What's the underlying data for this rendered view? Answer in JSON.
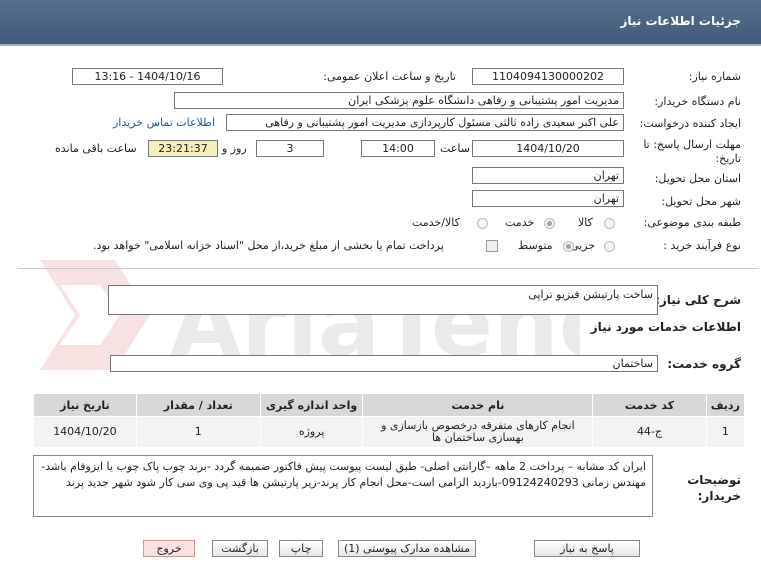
{
  "header": {
    "title": "جزئیات اطلاعات نیاز"
  },
  "form": {
    "need_number_label": "شماره نیاز:",
    "need_number": "1104094130000202",
    "announce_label": "تاریخ و ساعت اعلان عمومی:",
    "announce_value": "1404/10/16 - 13:16",
    "buyer_org_label": "نام دستگاه خریدار:",
    "buyer_org": "مدیریت امور پشتیبانی و رفاهی دانشگاه علوم پزشکی ایران",
    "creator_label": "ایجاد کننده درخواست:",
    "creator": "علی اکبر سعیدی زاده ثالثی مسئول کارپردازی مدیریت امور پشتیبانی و رفاهی",
    "contact_link": "اطلاعات تماس خریدار",
    "deadline_label_1": "مهلت ارسال پاسخ: تا",
    "deadline_label_2": "تاریخ:",
    "deadline_date": "1404/10/20",
    "time_label": "ساعت",
    "deadline_time": "14:00",
    "days_value": "3",
    "days_label": "روز و",
    "remaining_time": "23:21:37",
    "remaining_label": "ساعت باقی مانده",
    "province_label": "استان محل تحویل:",
    "province": "تهران",
    "city_label": "شهر محل تحویل:",
    "city": "تهران",
    "category_label": "طبقه بندی موضوعی:",
    "category_options": [
      "کالا",
      "خدمت",
      "کالا/خدمت"
    ],
    "process_label": "نوع فرآیند خرید :",
    "process_options": [
      "جزیی",
      "متوسط"
    ],
    "payment_text": "پرداخت تمام یا بخشی از مبلغ خرید،از محل \"اسناد خزانه اسلامی\" خواهد بود."
  },
  "summary": {
    "label": "شرح کلی نیاز:",
    "value": "ساخت پارتیشن فیزیو تراپی"
  },
  "services": {
    "section_title": "اطلاعات خدمات مورد نیاز",
    "group_label": "گروه خدمت:",
    "group_value": "ساختمان",
    "columns": [
      "ردیف",
      "کد خدمت",
      "نام خدمت",
      "واحد اندازه گیری",
      "تعداد / مقدار",
      "تاریخ نیاز"
    ],
    "rows": [
      [
        "1",
        "ج-44",
        "انجام کارهای متفرقه درخصوص بازسازی و بهسازی ساختمان ها",
        "پروژه",
        "1",
        "1404/10/20"
      ]
    ]
  },
  "buyer_notes": {
    "label_1": "توضیحات",
    "label_2": "خریدار:",
    "text": "ایران کد مشابه – پرداخت 2 ماهه –گارانتی اصلی- طبق لیست پیوست پیش فاکتور ضمیمه گردد -برند چوب پاک چوب یا ایزوفام باشد-مهندس زمانی 09124240293-بازدید الزامی است-محل انجام کار پرند-زیر پارتیشن ها قید پی وی سی کار شود شهر جدید پرند"
  },
  "buttons": {
    "reply": "پاسخ به نیاز",
    "attachments": "مشاهده مدارک پیوستی (1)",
    "print": "چاپ",
    "back": "بازگشت",
    "exit": "خروج"
  }
}
